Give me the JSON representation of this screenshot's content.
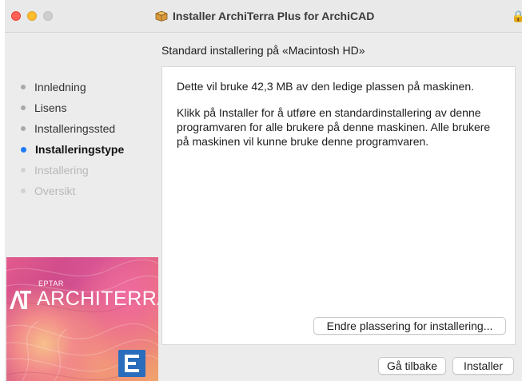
{
  "window": {
    "title": "Installer ArchiTerra Plus for ArchiCAD"
  },
  "header": {
    "subtitle": "Standard installering på «Macintosh HD»"
  },
  "sidebar": {
    "items": [
      {
        "label": "Innledning",
        "state": "done"
      },
      {
        "label": "Lisens",
        "state": "done"
      },
      {
        "label": "Installeringssted",
        "state": "done"
      },
      {
        "label": "Installeringstype",
        "state": "active"
      },
      {
        "label": "Installering",
        "state": "pending"
      },
      {
        "label": "Oversikt",
        "state": "pending"
      }
    ]
  },
  "brand": {
    "small_text": "EPTAR",
    "wordmark": "ARCHITERRA",
    "logo_text": "AT"
  },
  "content": {
    "paragraph1": "Dette vil bruke 42,3 MB av den ledige plassen på maskinen.",
    "paragraph2": "Klikk på Installer for å utføre en standardinstallering av denne programvaren for alle brukere på denne maskinen. Alle brukere på maskinen vil kunne bruke denne programvaren.",
    "change_location_label": "Endre plassering for installering..."
  },
  "footer": {
    "back_label": "Gå tilbake",
    "install_label": "Installer"
  },
  "colors": {
    "accent": "#1f7bf6",
    "close": "#fe5f57",
    "minimize": "#febc2e"
  },
  "icons": {
    "title_icon": "package-icon",
    "lock": "lock-icon",
    "corner_badge": "eptar-e-icon"
  }
}
